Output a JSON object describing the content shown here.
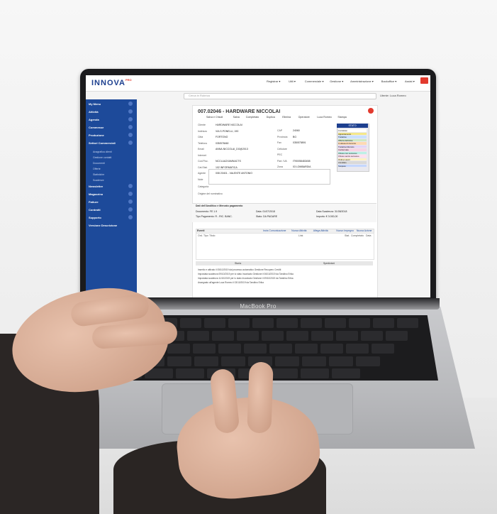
{
  "laptop_label": "MacBook Pro",
  "app": {
    "brand": "INNOVA",
    "brand_sup": "PRO",
    "top_nav": [
      "Registrar ▾",
      "Utili ▾",
      "Commerciale ▾",
      "Gestione ▾",
      "Amministrazione ▾",
      "Backoffice ▾",
      "Assist ▾"
    ],
    "search_placeholder": "Cerca in Rubrica",
    "user": "Utente: Luca Romeo",
    "sidebar": {
      "items": [
        "My Menu",
        "Attività",
        "Agenda",
        "Commesse",
        "Produzione",
        "Settori Commerciali",
        "Newsletter",
        "Magazzino",
        "Fatture",
        "Contratti",
        "Supporto",
        "Versione Descrizione"
      ],
      "subitems": [
        "Anagrafica clienti",
        "Gestione contatti",
        "Documenti",
        "Offerte",
        "Statistiche",
        "Scadenze"
      ]
    },
    "document": {
      "title": "007.02046 - HARDWARE NICCOLAI",
      "toolbar": [
        "Salva e Chiudi",
        "Salva",
        "Completato",
        "Duplica",
        "Elimina",
        "Operatore",
        "Luca Romeo",
        "Stampa"
      ],
      "fields": [
        {
          "label": "Cliente",
          "value": "HARDWARE NICCOLAI"
        },
        {
          "label": "Indirizzo",
          "value": "VIA S.PONELLI, 190"
        },
        {
          "label": "Città",
          "value": "FORTONO"
        },
        {
          "label": "Telefono",
          "value": "035/578460"
        },
        {
          "label": "Email",
          "value": "ANNA.NICCOLAI_DG@2013"
        },
        {
          "label": "Internet",
          "value": ""
        },
        {
          "label": "Cod.Fisc.",
          "value": "NCCLUA2XAMNACTS"
        },
        {
          "label": "Cat.Stat.",
          "value": "102 INFORMATICA"
        },
        {
          "label": "Agente",
          "value": "008 20401 - VALENTE ANTONIO"
        },
        {
          "label": "Note",
          "value": ""
        }
      ],
      "fields_right": [
        {
          "label": "CAP",
          "value": "24060"
        },
        {
          "label": "Provincia",
          "value": "BG"
        },
        {
          "label": "Fax",
          "value": "035/575891"
        },
        {
          "label": "Cellulare",
          "value": ""
        },
        {
          "label": "PEC",
          "value": ""
        },
        {
          "label": "Part. IVA",
          "value": "IT90058483458"
        },
        {
          "label": "Zona",
          "value": "03 LOMBARDIA"
        }
      ],
      "stato": {
        "title": "STATO",
        "options": [
          "Contattato",
          "Appuntamento",
          "Trattativa",
          "Offerta definitiva",
          "In attesa di riscontro",
          "Trattativa Mercato",
          "Confermata",
          "Chiuso con successo",
          "Chiuso senza successo",
          "Ordine Lavori",
          "Annullato",
          "Sospeso"
        ],
        "colors": [
          "#ffffff",
          "#f5e88a",
          "#c9e0ff",
          "#cde9c4",
          "#ffd9b3",
          "#e4d4f7",
          "#f7d4e4",
          "#bdf0e6",
          "#ffe0ef",
          "#fff1c4",
          "#d9d9d9",
          "#c4d7ff"
        ]
      },
      "category_label": "Categoria",
      "source_label": "Origine del nominativo",
      "section2_title": "Dati dell'Anolitico e Mercato pagamento",
      "section2_fields": [
        "Documento: FE 1.9",
        "Data: 01/07/2018",
        "Data Scadenza: 31/08/2018",
        "Tipo Pagamento: R - RIC. BANC.",
        "Stato: DA PAGARE",
        "Importo: € 3.000,00"
      ],
      "eventi_title": "Eventi",
      "eventi_actions": [
        "Invia Comunicazione",
        "Nuova Attività",
        "Allega Attività",
        "Nuovo Impegno",
        "Nuova Azione"
      ],
      "eventi_cols": [
        "Ord.",
        "Tipo",
        "Titolo",
        "Link",
        "Stat.",
        "Completato",
        "Data"
      ],
      "tabs": [
        "Storia",
        "Spedizioni"
      ],
      "log": [
        "Inserito e attivato il 05/10/2019 dal processo automatico Gestione Recupero Crediti",
        "Impostata scadenza 09/10/2019 per lo stato Incaricato Gestione il 06/10/2019 da Tarsitino Erika",
        "Impostata scadenza 11/10/2019 per lo stato Incaricato Gestione il 09/10/2019 da Tarsitino Erika",
        "Assegnato all'agente Luca Romeo il 03/10/2019 da Tarsitino Erika"
      ]
    }
  },
  "colors": {
    "sidebar": "#1d4a9a",
    "brand": "#1c3f8f",
    "accent_red": "#e23a2e",
    "laptop_dark": "#1b1b1d",
    "aluminium": "#c0c1c4"
  }
}
